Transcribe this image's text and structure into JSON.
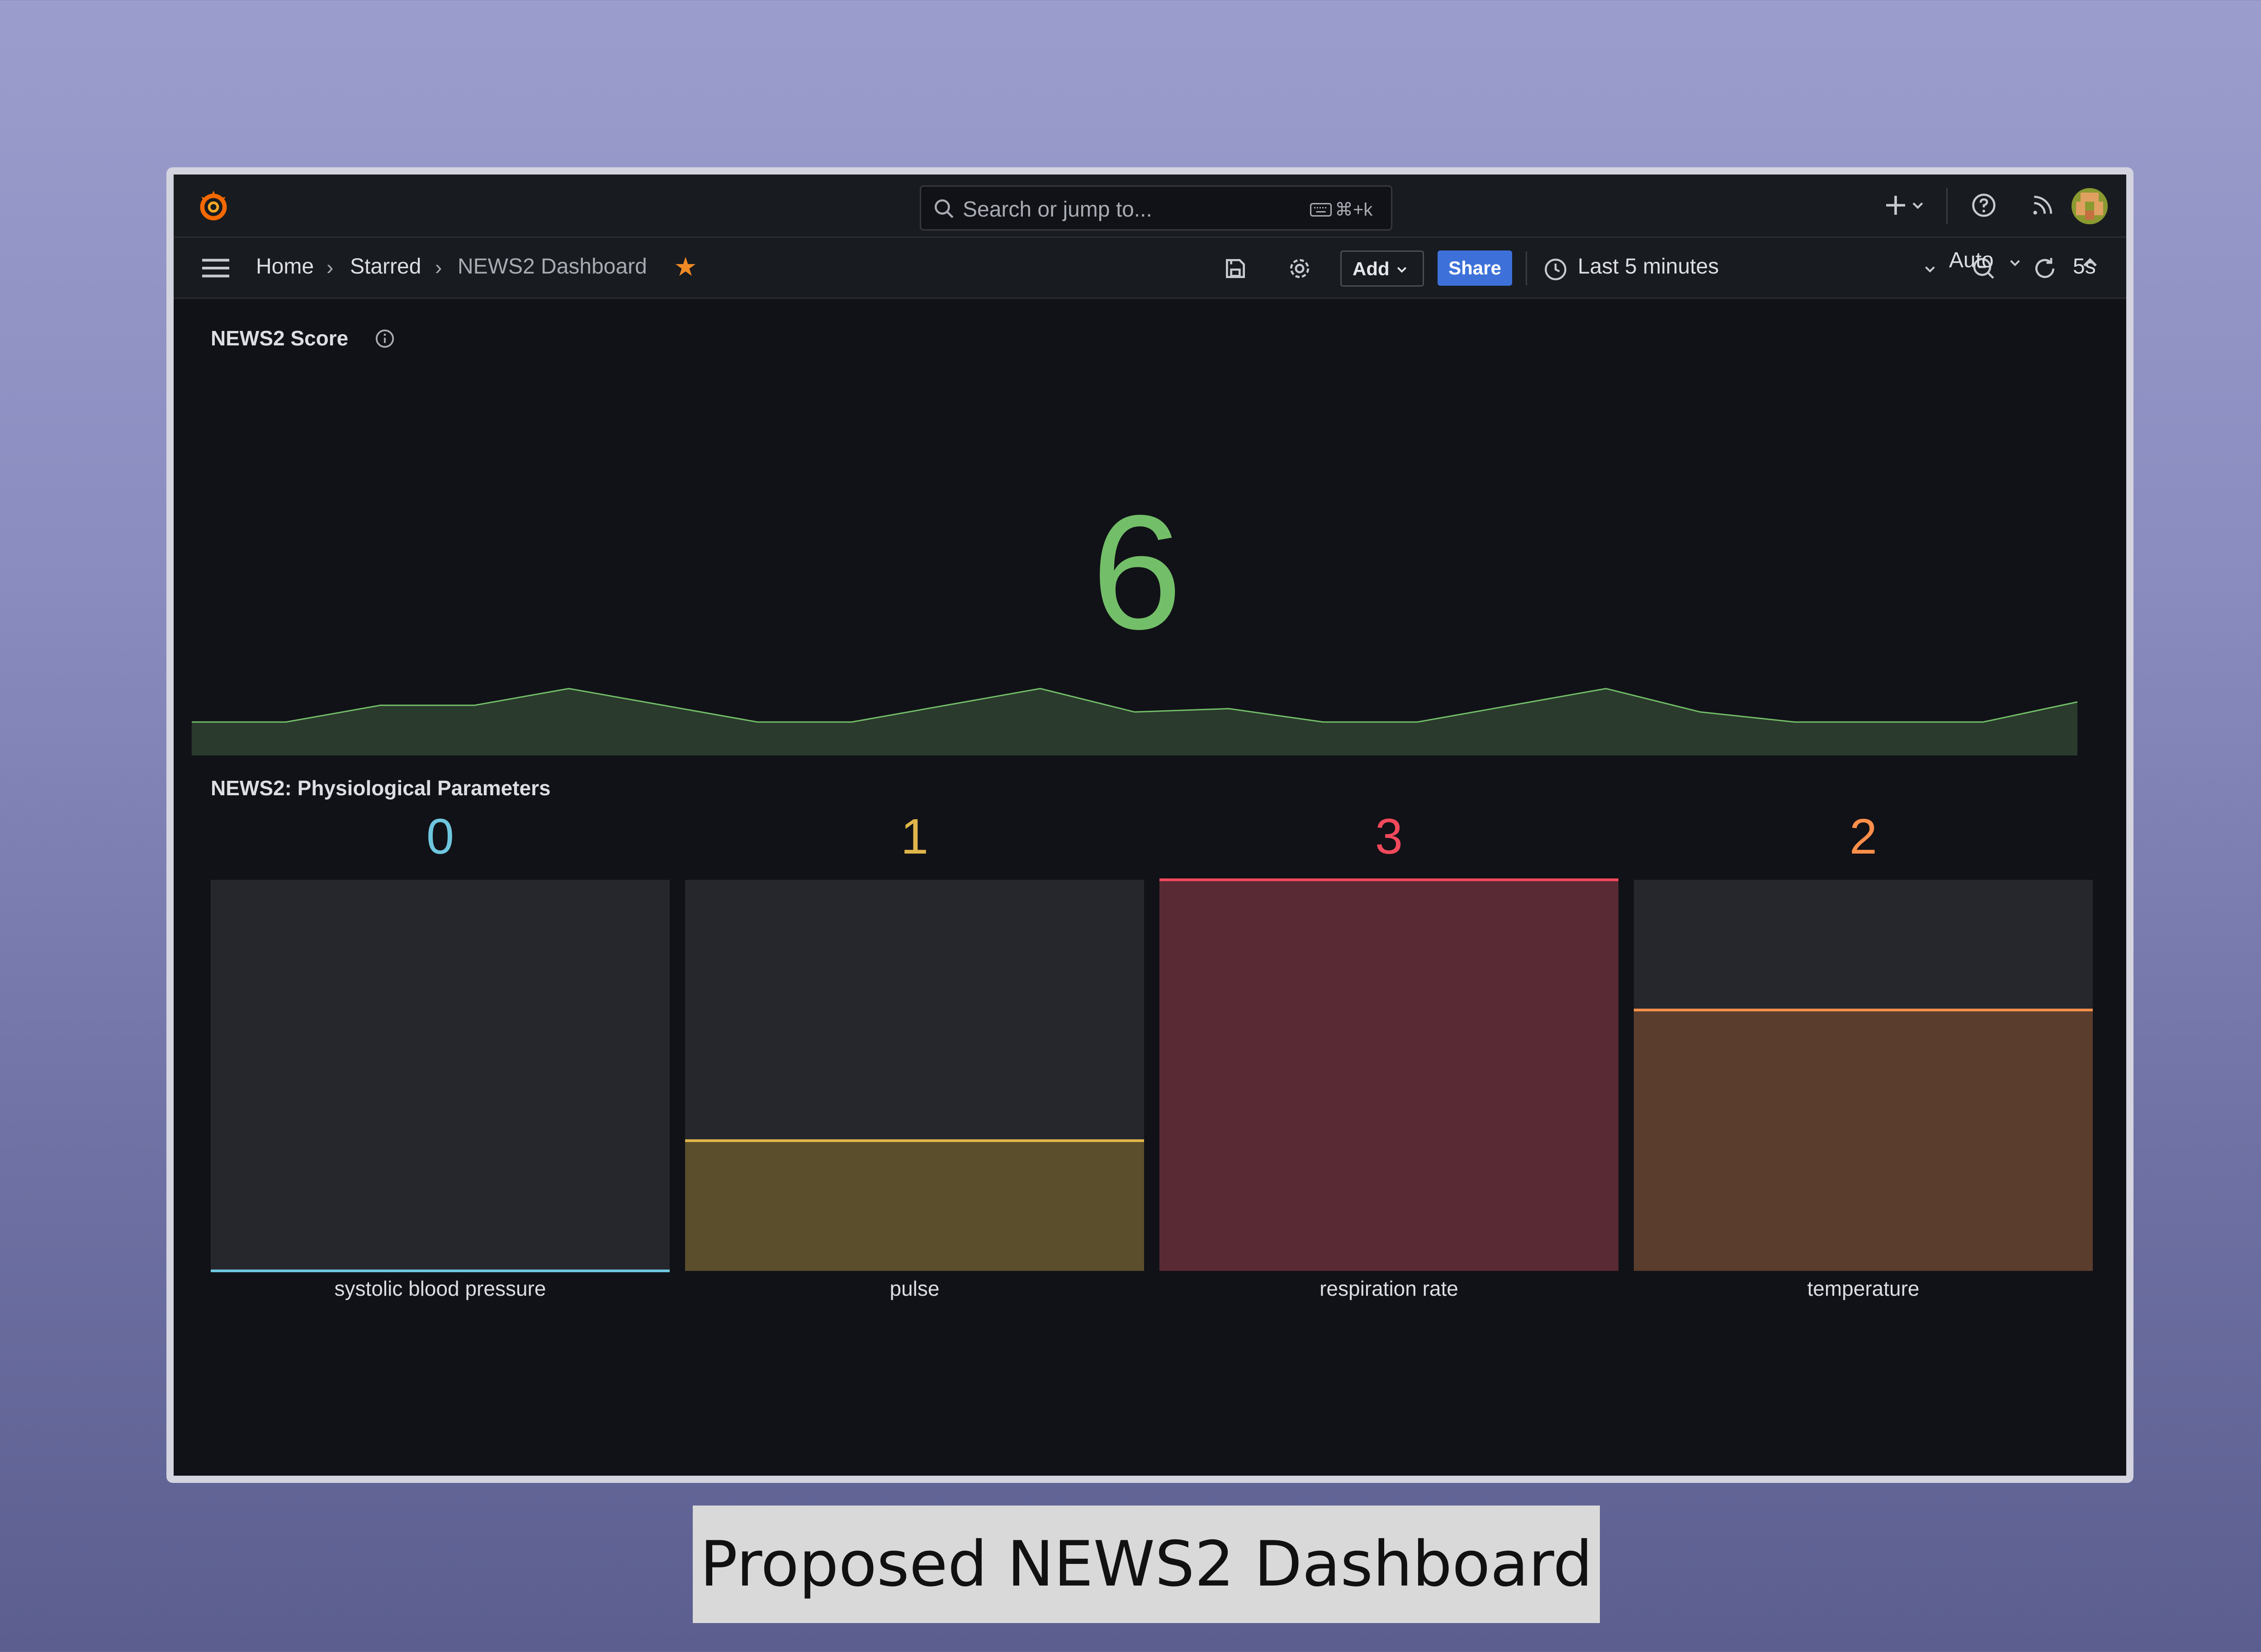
{
  "topbar": {
    "search_placeholder": "Search or jump to...",
    "search_shortcut": "⌘+k",
    "add_icon": "plus-icon",
    "help_icon": "help-circle-icon",
    "news_icon": "rss-icon",
    "avatar": "user-avatar"
  },
  "breadcrumb": {
    "home": "Home",
    "starred": "Starred",
    "current": "NEWS2 Dashboard"
  },
  "toolbar": {
    "add_label": "Add",
    "share_label": "Share",
    "time_range": "Last 5 minutes",
    "refresh_interval": "5s",
    "auto_label": "Auto"
  },
  "score_panel": {
    "title": "NEWS2 Score",
    "value": "6",
    "color": "#73bf69",
    "sparkline": [
      2,
      2,
      3,
      3,
      4,
      3,
      2,
      2,
      3,
      4,
      2.6,
      2.8,
      2,
      2,
      3,
      4,
      2.6,
      2,
      2,
      2,
      3.2
    ]
  },
  "params_panel": {
    "title": "NEWS2: Physiological Parameters",
    "max": 3,
    "gauges": [
      {
        "label": "systolic blood pressure",
        "value": "0",
        "fraction": 0.0,
        "color": "#6ec6de",
        "fill": "#25272d"
      },
      {
        "label": "pulse",
        "value": "1",
        "fraction": 0.333,
        "color": "#e0b54a",
        "fill": "#5b4e2c"
      },
      {
        "label": "respiration rate",
        "value": "3",
        "fraction": 1.0,
        "color": "#f2495c",
        "fill": "#5a2a34"
      },
      {
        "label": "temperature",
        "value": "2",
        "fraction": 0.667,
        "color": "#ff8f4a",
        "fill": "#5a3d2d"
      }
    ]
  },
  "caption": "Proposed NEWS2 Dashboard"
}
